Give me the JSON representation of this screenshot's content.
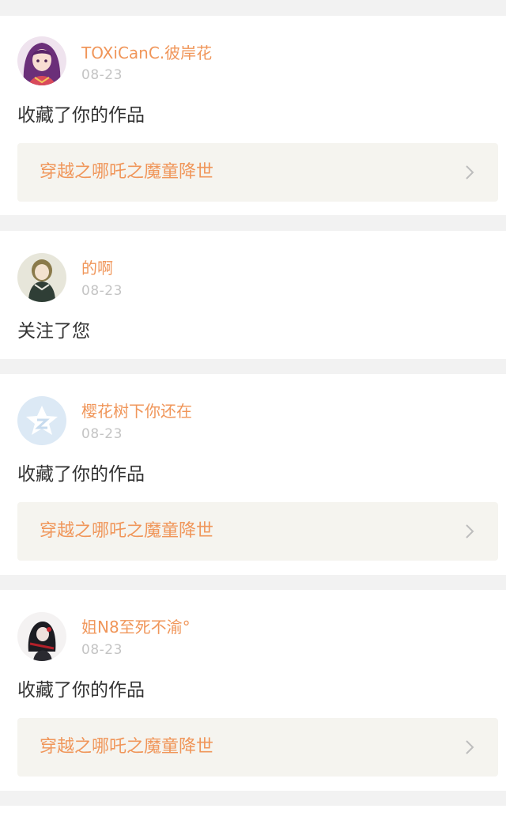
{
  "colors": {
    "background": "#f2f2f2",
    "card": "#ffffff",
    "accent": "#f0965a",
    "date": "#c4c4c4",
    "text": "#333333",
    "link_bg": "#f5f4ef"
  },
  "notifications": [
    {
      "username": "TOXiCanC.彼岸花",
      "date": "08-23",
      "action": "收藏了你的作品",
      "work_title": "穿越之哪吒之魔童降世",
      "avatar_icon": "anime-girl-purple-hair-avatar"
    },
    {
      "username": "的啊",
      "date": "08-23",
      "action": "关注了您",
      "avatar_icon": "anime-girl-green-dress-avatar"
    },
    {
      "username": "樱花树下你还在",
      "date": "08-23",
      "action": "收藏了你的作品",
      "work_title": "穿越之哪吒之魔童降世",
      "avatar_icon": "qzone-default-avatar"
    },
    {
      "username": "姐N8至死不渝°",
      "date": "08-23",
      "action": "收藏了你的作品",
      "work_title": "穿越之哪吒之魔童降世",
      "avatar_icon": "dark-anime-character-avatar"
    }
  ]
}
